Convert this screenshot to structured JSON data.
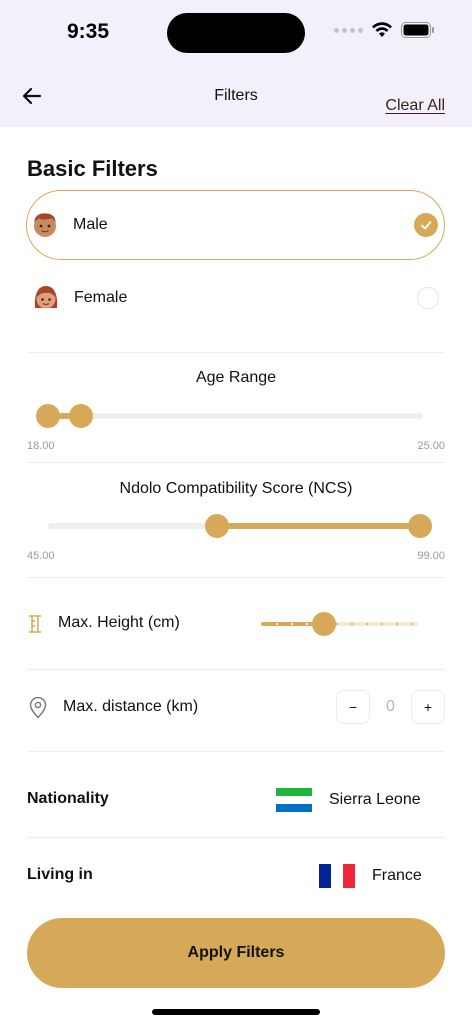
{
  "status": {
    "time": "9:35"
  },
  "header": {
    "title": "Filters",
    "clear_label": "Clear All"
  },
  "basic": {
    "title": "Basic Filters",
    "genders": [
      {
        "label": "Male",
        "selected": true
      },
      {
        "label": "Female",
        "selected": false
      }
    ]
  },
  "age": {
    "label": "Age Range",
    "min_text": "18.00",
    "max_text": "25.00",
    "low": 18,
    "high": 25,
    "scale_min": 18,
    "scale_max": 99
  },
  "ncs": {
    "label": "Ndolo Compatibility Score (NCS)",
    "min_text": "45.00",
    "max_text": "99.00",
    "low": 66,
    "high": 99,
    "scale_min": 45,
    "scale_max": 99
  },
  "height": {
    "label": "Max. Height (cm)",
    "level": 0.4,
    "icon": "height-icon"
  },
  "distance": {
    "label": "Max. distance (km)",
    "value": "0",
    "minus": "−",
    "plus": "+",
    "icon": "location-pin-icon"
  },
  "nationality": {
    "label": "Nationality",
    "value": "Sierra Leone",
    "flag_colors": [
      "#1eb53a",
      "#ffffff",
      "#0072c6"
    ]
  },
  "living": {
    "label": "Living in",
    "value": "France",
    "flag_colors": [
      "#002395",
      "#ffffff",
      "#ed2939"
    ]
  },
  "apply_label": "Apply Filters",
  "colors": {
    "accent": "#d6a958",
    "header_bg": "#f3f0fc"
  }
}
